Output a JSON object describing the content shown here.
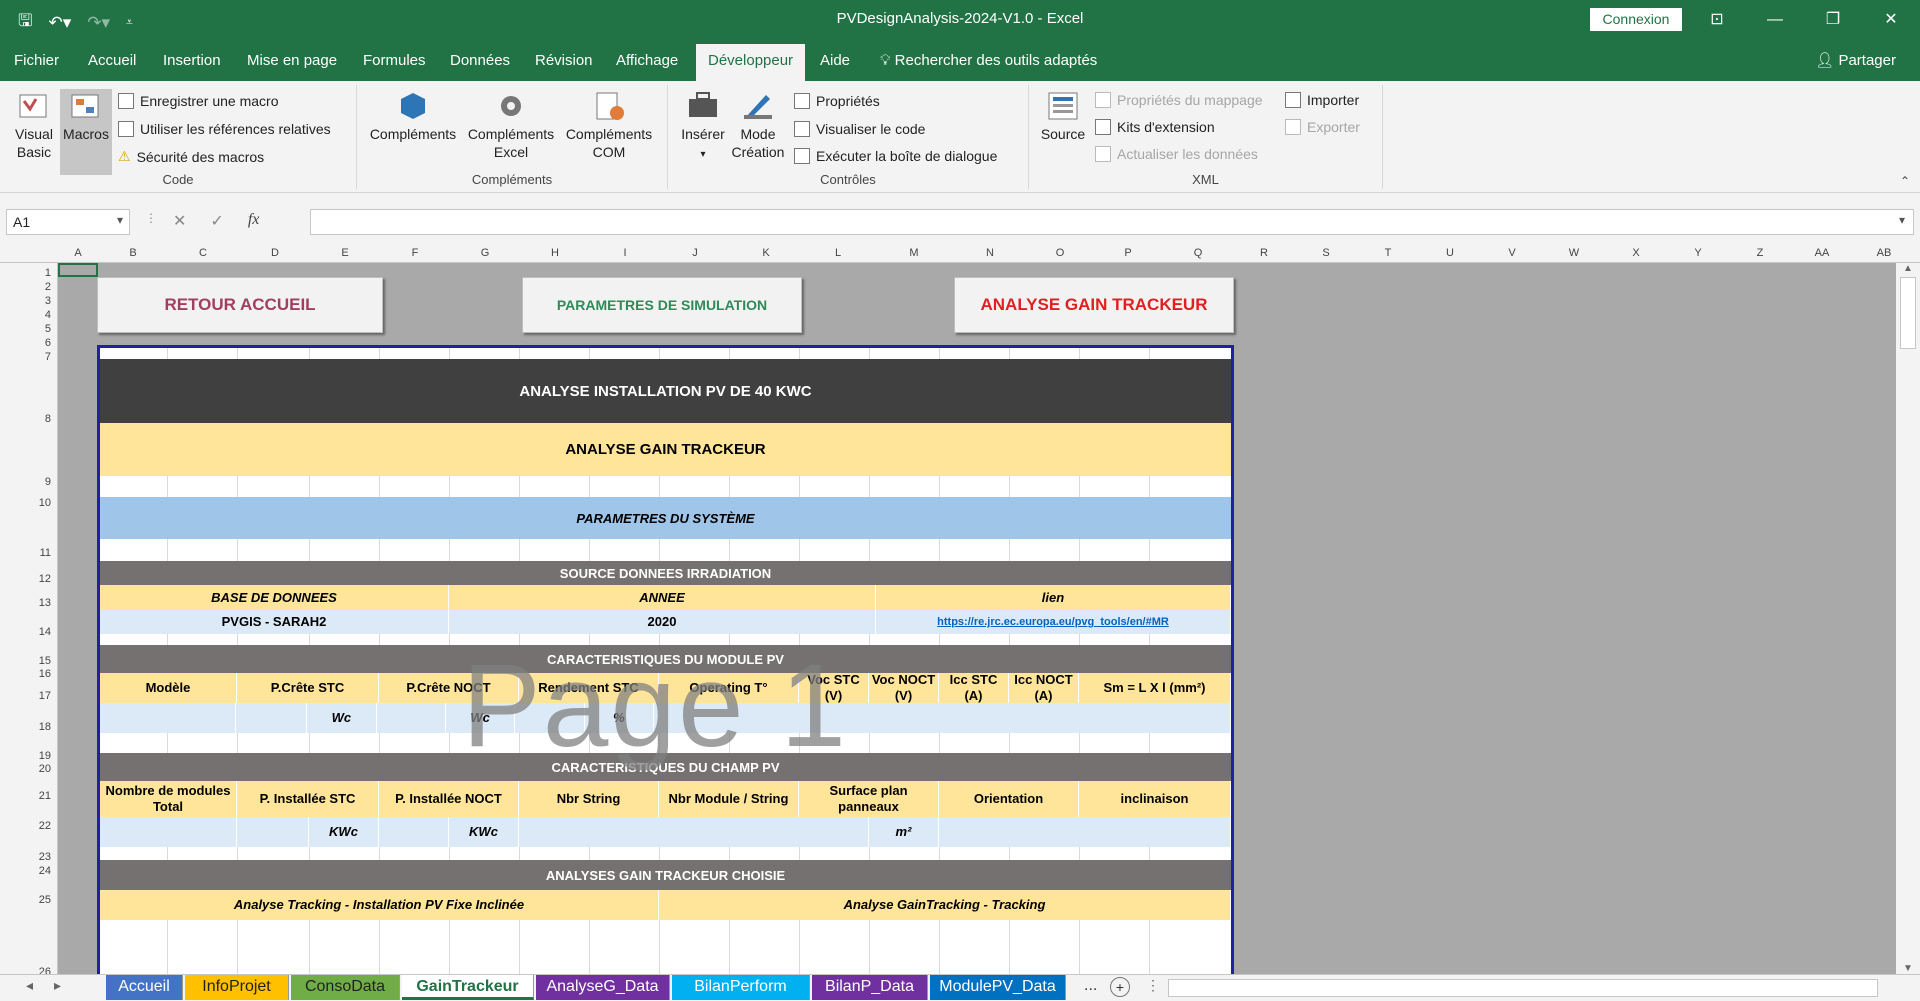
{
  "window": {
    "title": "PVDesignAnalysis-2024-V1.0  -  Excel",
    "connexion_label": "Connexion",
    "qat_icons": [
      "save-icon",
      "undo-icon",
      "redo-icon",
      "customize-icon"
    ]
  },
  "menu": {
    "tabs": [
      "Fichier",
      "Accueil",
      "Insertion",
      "Mise en page",
      "Formules",
      "Données",
      "Révision",
      "Affichage",
      "Développeur",
      "Aide"
    ],
    "active": "Développeur",
    "search": "Rechercher des outils adaptés",
    "share": "Partager"
  },
  "ribbon": {
    "code": {
      "label": "Code",
      "visual_basic": "Visual Basic",
      "macros": "Macros",
      "record_macro": "Enregistrer une macro",
      "relative_refs": "Utiliser les références relatives",
      "macro_security": "Sécurité des macros"
    },
    "complements": {
      "label": "Compléments",
      "addins": "Compléments",
      "excel_addins_l1": "Compléments",
      "excel_addins_l2": "Excel",
      "com_addins_l1": "Compléments",
      "com_addins_l2": "COM"
    },
    "controls": {
      "label": "Contrôles",
      "insert": "Insérer",
      "design_l1": "Mode",
      "design_l2": "Création",
      "properties": "Propriétés",
      "view_code": "Visualiser le code",
      "run_dialog": "Exécuter la boîte de dialogue"
    },
    "xml": {
      "label": "XML",
      "source": "Source",
      "map_props": "Propriétés du mappage",
      "expansion_packs": "Kits d'extension",
      "refresh_data": "Actualiser les données",
      "import": "Importer",
      "export": "Exporter"
    }
  },
  "formula_bar": {
    "name_box": "A1",
    "formula": "",
    "fx": "fx"
  },
  "columns": [
    "A",
    "B",
    "C",
    "D",
    "E",
    "F",
    "G",
    "H",
    "I",
    "J",
    "K",
    "L",
    "M",
    "N",
    "O",
    "P",
    "Q",
    "R",
    "S",
    "T",
    "U",
    "V",
    "W",
    "X",
    "Y",
    "Z",
    "AA",
    "AB"
  ],
  "rows": [
    "1",
    "2",
    "3",
    "4",
    "5",
    "6",
    "7",
    "8",
    "9",
    "10",
    "11",
    "12",
    "13",
    "14",
    "15",
    "16",
    "17",
    "18",
    "19",
    "20",
    "21",
    "22",
    "23",
    "24",
    "25",
    "26"
  ],
  "nav_buttons": {
    "home": "RETOUR ACCUEIL",
    "params": "PARAMETRES DE SIMULATION",
    "tracker": "ANALYSE GAIN TRACKEUR"
  },
  "report": {
    "title": "ANALYSE INSTALLATION PV DE 40 KWC",
    "subtitle": "ANALYSE GAIN TRACKEUR",
    "system_params": "PARAMETRES DU SYSTÈME",
    "irradiation": {
      "header": "SOURCE DONNEES IRRADIATION",
      "col_db": "BASE DE DONNEES",
      "col_year": "ANNEE",
      "col_link": "lien",
      "db": "PVGIS - SARAH2",
      "year": "2020",
      "link": "https://re.jrc.ec.europa.eu/pvg_tools/en/#MR"
    },
    "module": {
      "header": "CARACTERISTIQUES DU MODULE PV",
      "cols": [
        "Modèle",
        "P.Crête STC",
        "P.Crête NOCT",
        "Rendement STC",
        "Operating T°",
        "Voc STC (V)",
        "Voc NOCT (V)",
        "Icc STC (A)",
        "Icc NOCT (A)",
        "Sm = L X l (mm²)"
      ],
      "unit_wc1": "Wc",
      "unit_wc2": "Wc",
      "unit_pct": "%"
    },
    "field": {
      "header": "CARACTERISTIQUES DU CHAMP PV",
      "cols": [
        "Nombre de modules Total",
        "P. Installée STC",
        "P. Installée NOCT",
        "Nbr String",
        "Nbr Module / String",
        "Surface plan panneaux",
        "Orientation",
        "inclinaison"
      ],
      "unit_kwc1": "KWc",
      "unit_kwc2": "KWc",
      "unit_m2": "m²"
    },
    "analysis": {
      "header": "ANALYSES GAIN TRACKEUR  CHOISIE",
      "left": "Analyse Tracking - Installation PV Fixe Inclinée",
      "right": "Analyse GainTracking - Tracking"
    }
  },
  "watermark": "Page 1",
  "sheets": [
    {
      "name": "Accueil",
      "color": "#4472c4"
    },
    {
      "name": "InfoProjet",
      "color": "#ffc000"
    },
    {
      "name": "ConsoData",
      "color": "#70ad47"
    },
    {
      "name": "GainTrackeur",
      "color": "#ffffff"
    },
    {
      "name": "AnalyseG_Data",
      "color": "#7030a0"
    },
    {
      "name": "BilanPerform",
      "color": "#00b0f0"
    },
    {
      "name": "BilanP_Data",
      "color": "#7030a0"
    },
    {
      "name": "ModulePV_Data",
      "color": "#0070c0"
    }
  ],
  "active_sheet": "GainTrackeur",
  "more_sheets": "...",
  "add_sheet": "+"
}
